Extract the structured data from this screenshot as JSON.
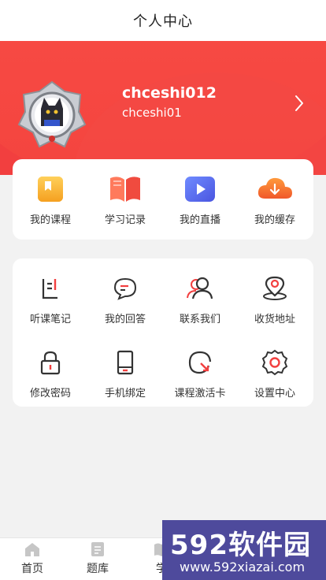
{
  "header": {
    "title": "个人中心"
  },
  "profile": {
    "username": "chceshi012",
    "user_id": "chceshi01"
  },
  "quick_actions": [
    {
      "label": "我的课程",
      "icon": "bookmark-book-icon"
    },
    {
      "label": "学习记录",
      "icon": "open-book-icon"
    },
    {
      "label": "我的直播",
      "icon": "video-play-icon"
    },
    {
      "label": "我的缓存",
      "icon": "cloud-download-icon"
    }
  ],
  "services": [
    {
      "label": "听课笔记",
      "icon": "notes-icon"
    },
    {
      "label": "我的回答",
      "icon": "chat-bubble-icon"
    },
    {
      "label": "联系我们",
      "icon": "contacts-icon"
    },
    {
      "label": "收货地址",
      "icon": "location-pin-icon"
    },
    {
      "label": "修改密码",
      "icon": "lock-icon"
    },
    {
      "label": "手机绑定",
      "icon": "phone-icon"
    },
    {
      "label": "课程激活卡",
      "icon": "activation-icon"
    },
    {
      "label": "设置中心",
      "icon": "gear-icon"
    }
  ],
  "tabbar": {
    "home_label": "首页",
    "questions_label": "题库",
    "study_label": "学"
  },
  "watermark": {
    "brand": "592软件园",
    "url": "www.592xiazai.com"
  },
  "colors": {
    "accent": "#f23f3f",
    "orange": "#f5a623",
    "blue": "#5b6cf0"
  }
}
